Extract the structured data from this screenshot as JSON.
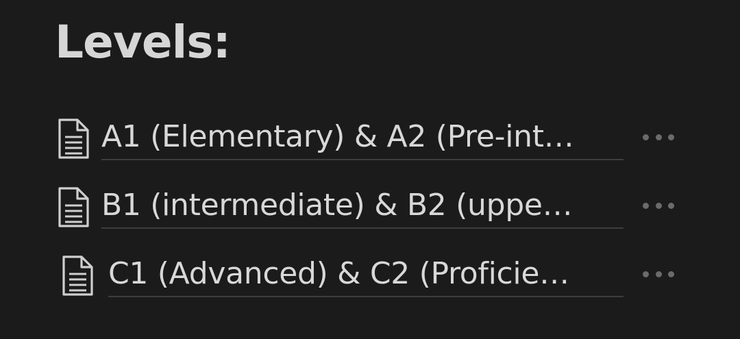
{
  "heading": "Levels:",
  "pages": [
    {
      "title": "A1 (Elementary) & A2 (Pre-int…",
      "icon": "document-icon",
      "more_icon": "more-options-icon"
    },
    {
      "title": "B1 (intermediate) & B2 (uppe…",
      "icon": "document-icon",
      "more_icon": "more-options-icon"
    },
    {
      "title": "C1 (Advanced) & C2 (Proficie…",
      "icon": "document-icon",
      "more_icon": "more-options-icon"
    }
  ],
  "colors": {
    "background": "#1b1b1b",
    "text": "#d8d8d8",
    "underline": "#3e3e3e",
    "muted": "#6b6b6b"
  }
}
